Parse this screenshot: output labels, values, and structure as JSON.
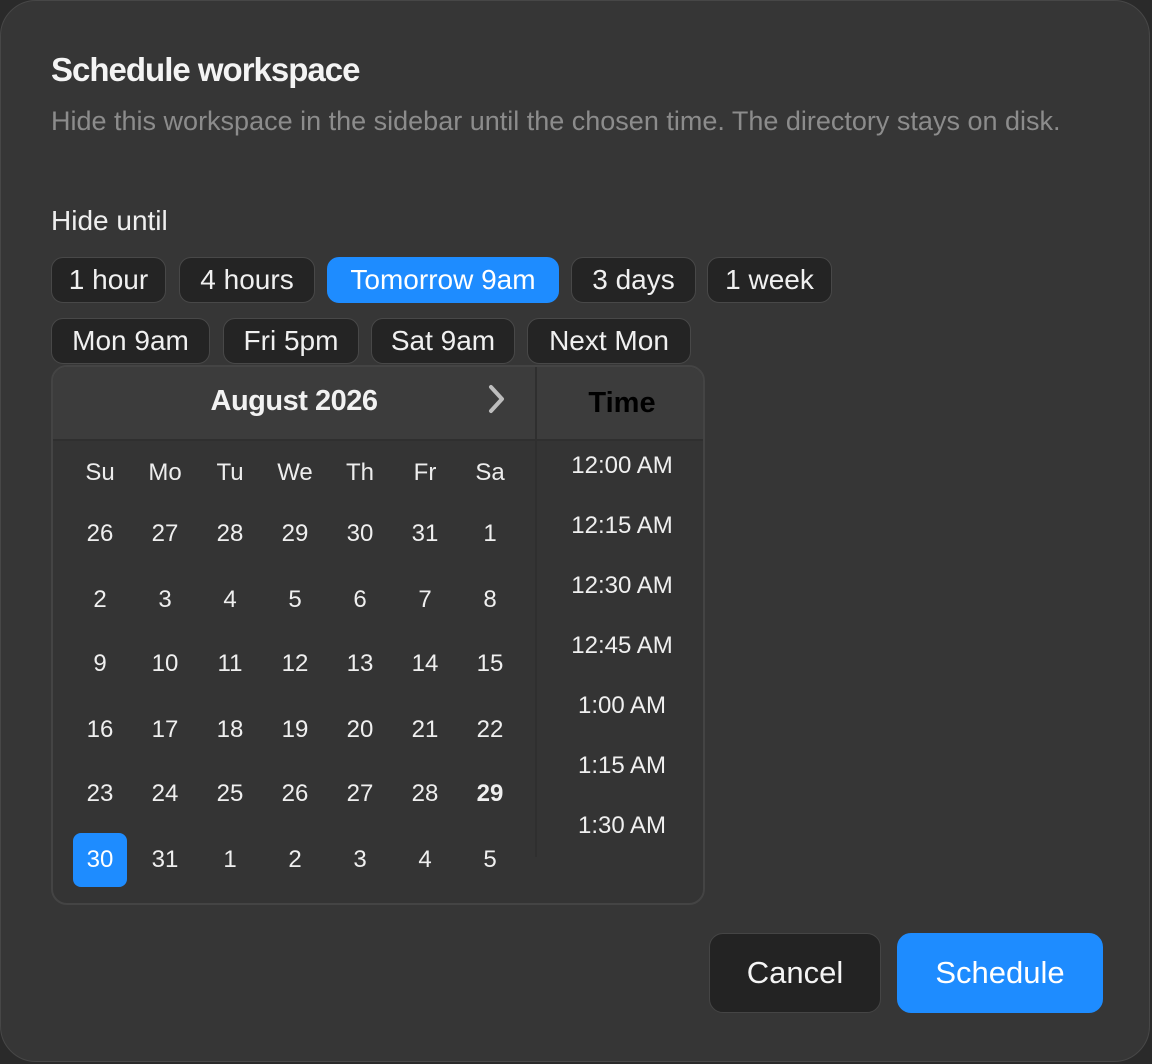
{
  "dialog": {
    "title": "Schedule workspace",
    "description": "Hide this workspace in the sidebar until the chosen time. The directory stays on disk.",
    "hide_until_label": "Hide until"
  },
  "presets": [
    {
      "label": "1 hour",
      "selected": false
    },
    {
      "label": "4 hours",
      "selected": false
    },
    {
      "label": "Tomorrow 9am",
      "selected": true
    },
    {
      "label": "3 days",
      "selected": false
    },
    {
      "label": "1 week",
      "selected": false
    },
    {
      "label": "Mon 9am",
      "selected": false
    },
    {
      "label": "Fri 5pm",
      "selected": false
    },
    {
      "label": "Sat 9am",
      "selected": false
    },
    {
      "label": "Next Mon",
      "selected": false
    }
  ],
  "calendar": {
    "month_label": "August 2026",
    "weekdays": [
      "Su",
      "Mo",
      "Tu",
      "We",
      "Th",
      "Fr",
      "Sa"
    ],
    "days": [
      "26",
      "27",
      "28",
      "29",
      "30",
      "31",
      "1",
      "2",
      "3",
      "4",
      "5",
      "6",
      "7",
      "8",
      "9",
      "10",
      "11",
      "12",
      "13",
      "14",
      "15",
      "16",
      "17",
      "18",
      "19",
      "20",
      "21",
      "22",
      "23",
      "24",
      "25",
      "26",
      "27",
      "28",
      "29",
      "30",
      "31",
      "1",
      "2",
      "3",
      "4",
      "5"
    ],
    "today": "29",
    "selected": "30"
  },
  "time": {
    "header": "Time",
    "options": [
      "12:00 AM",
      "12:15 AM",
      "12:30 AM",
      "12:45 AM",
      "1:00 AM",
      "1:15 AM",
      "1:30 AM"
    ]
  },
  "actions": {
    "cancel_label": "Cancel",
    "schedule_label": "Schedule"
  },
  "colors": {
    "accent": "#1e8cff",
    "surface": "#363636",
    "chip_bg": "#242424"
  }
}
